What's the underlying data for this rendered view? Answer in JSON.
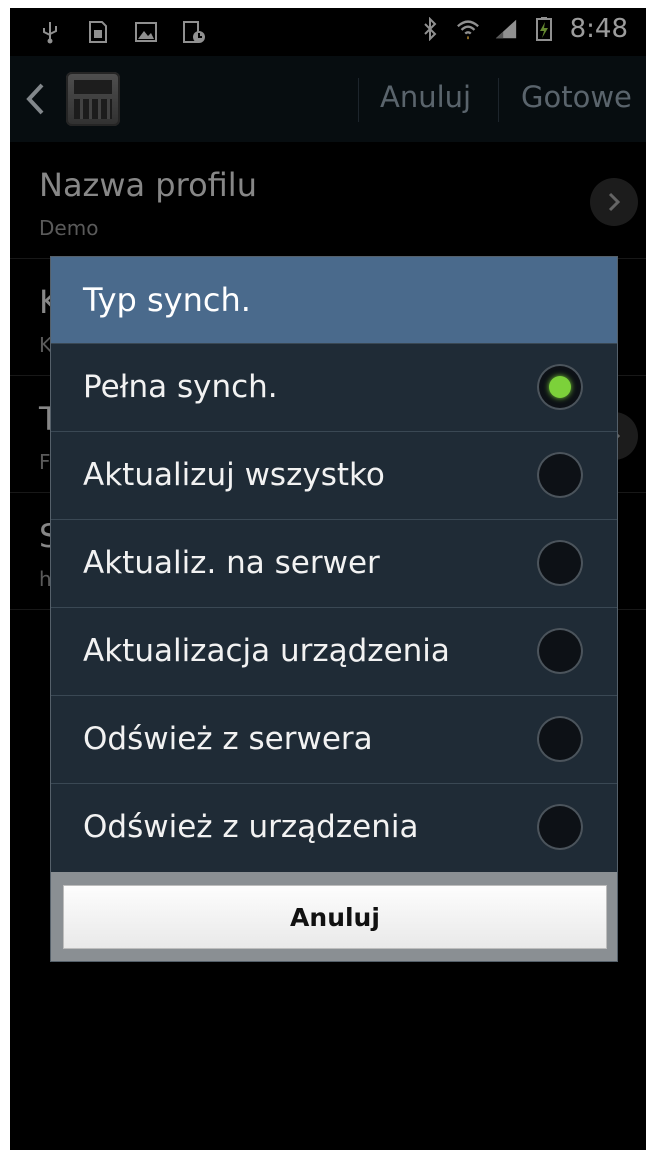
{
  "status_bar": {
    "time": "8:48",
    "icons_left": [
      "usb-icon",
      "sim-icon",
      "image-icon",
      "device-sync-icon"
    ],
    "icons_right": [
      "bluetooth-icon",
      "wifi-icon",
      "signal-icon",
      "battery-charging-icon"
    ]
  },
  "action_bar": {
    "cancel_label": "Anuluj",
    "done_label": "Gotowe"
  },
  "background_list": [
    {
      "title": "Nazwa profilu",
      "subtitle": "Demo"
    },
    {
      "title": "K",
      "subtitle": "K"
    },
    {
      "title": "T",
      "subtitle": "F"
    },
    {
      "title": "S",
      "subtitle": "h"
    }
  ],
  "dialog": {
    "title": "Typ synch.",
    "options": [
      {
        "label": "Pełna synch.",
        "selected": true
      },
      {
        "label": "Aktualizuj wszystko",
        "selected": false
      },
      {
        "label": "Aktualiz. na serwer",
        "selected": false
      },
      {
        "label": "Aktualizacja urządzenia",
        "selected": false
      },
      {
        "label": "Odśwież z serwera",
        "selected": false
      },
      {
        "label": "Odśwież z urządzenia",
        "selected": false
      }
    ],
    "cancel_label": "Anuluj"
  },
  "colors": {
    "dialog_title_bg": "#4a6a8c",
    "option_bg": "#1f2b36",
    "radio_selected": "#7cd13a"
  }
}
